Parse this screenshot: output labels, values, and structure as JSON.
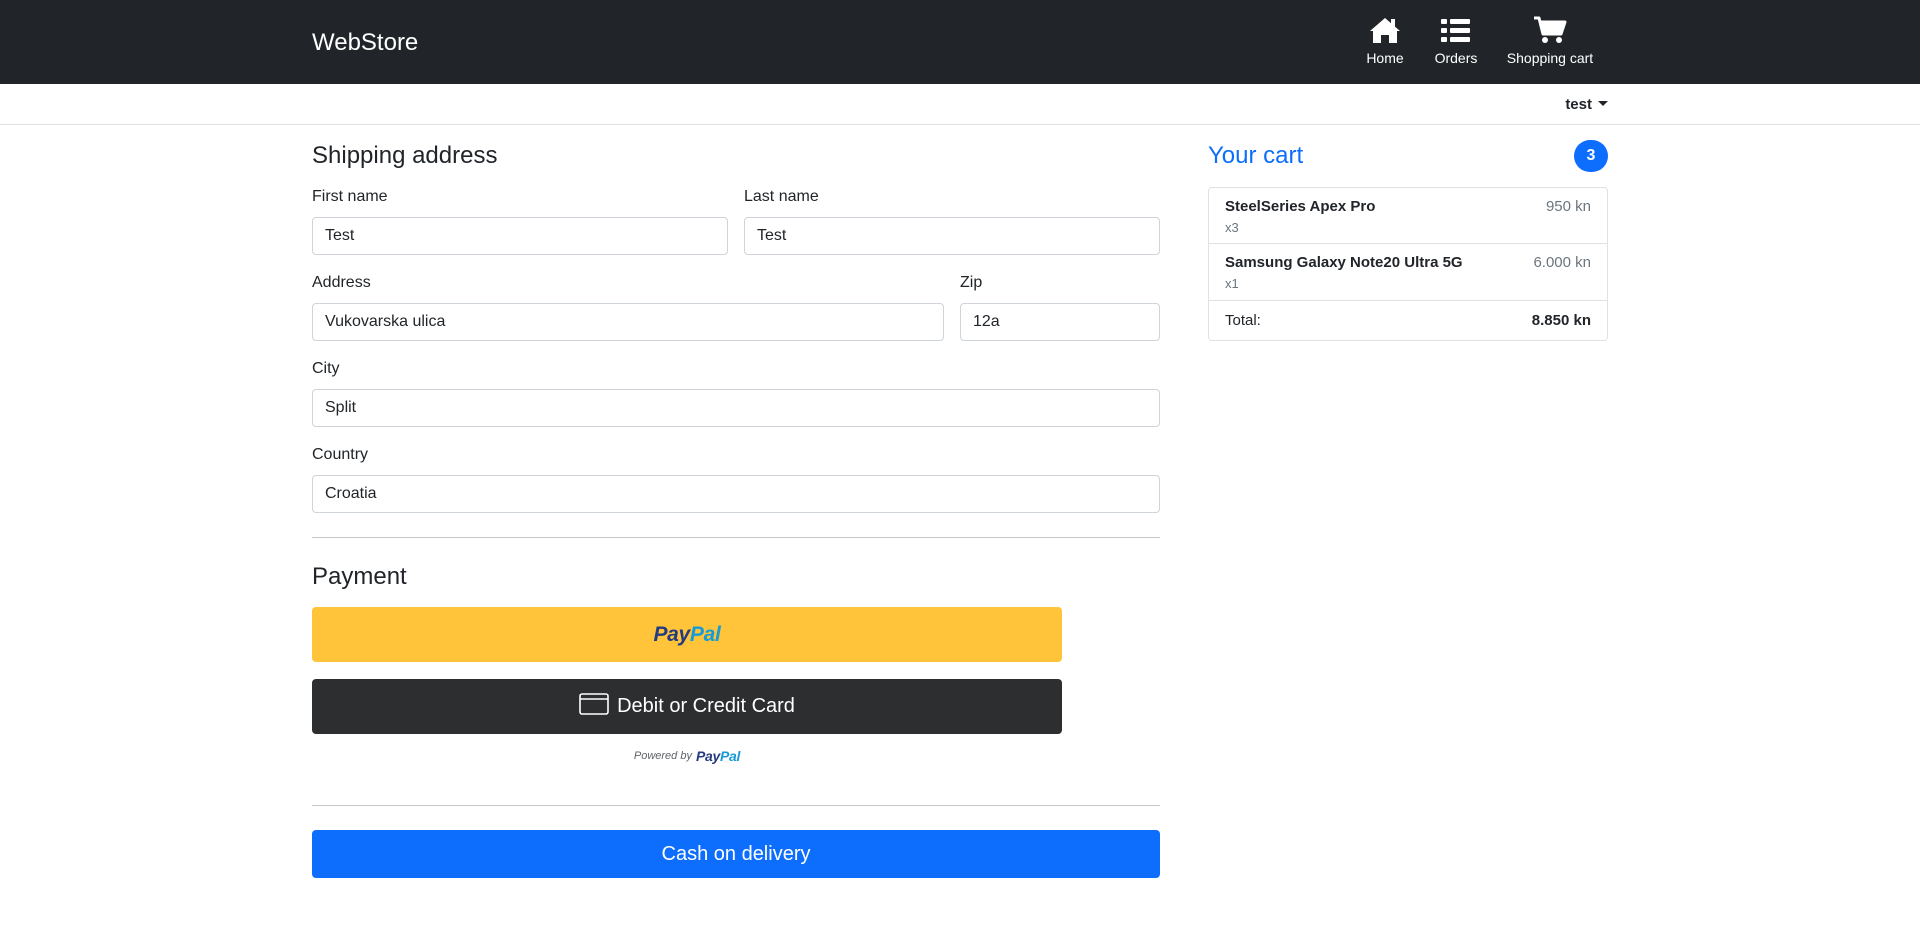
{
  "navbar": {
    "brand": "WebStore",
    "items": [
      {
        "label": "Home",
        "icon": "home-icon"
      },
      {
        "label": "Orders",
        "icon": "list-icon"
      },
      {
        "label": "Shopping cart",
        "icon": "cart-icon"
      }
    ],
    "background": "#212529"
  },
  "user": {
    "name": "test"
  },
  "shipping": {
    "title": "Shipping address",
    "first_name": {
      "label": "First name",
      "value": "Test"
    },
    "last_name": {
      "label": "Last name",
      "value": "Test"
    },
    "address": {
      "label": "Address",
      "value": "Vukovarska ulica"
    },
    "zip": {
      "label": "Zip",
      "value": "12a"
    },
    "city": {
      "label": "City",
      "value": "Split"
    },
    "country": {
      "label": "Country",
      "value": "Croatia"
    }
  },
  "payment": {
    "title": "Payment",
    "paypal_pay": "Pay",
    "paypal_pal": "Pal",
    "card_label": "Debit or Credit Card",
    "powered_by": "Powered by",
    "cash_on_delivery": "Cash on delivery",
    "colors": {
      "paypal": "#ffc439",
      "card": "#2c2e2f",
      "primary": "#0d6efd"
    }
  },
  "cart": {
    "title": "Your cart",
    "count": "3",
    "items": [
      {
        "name": "SteelSeries Apex Pro",
        "qty": "x3",
        "price": "950 kn"
      },
      {
        "name": "Samsung Galaxy Note20 Ultra 5G",
        "qty": "x1",
        "price": "6.000 kn"
      }
    ],
    "total_label": "Total:",
    "total_value": "8.850 kn"
  }
}
